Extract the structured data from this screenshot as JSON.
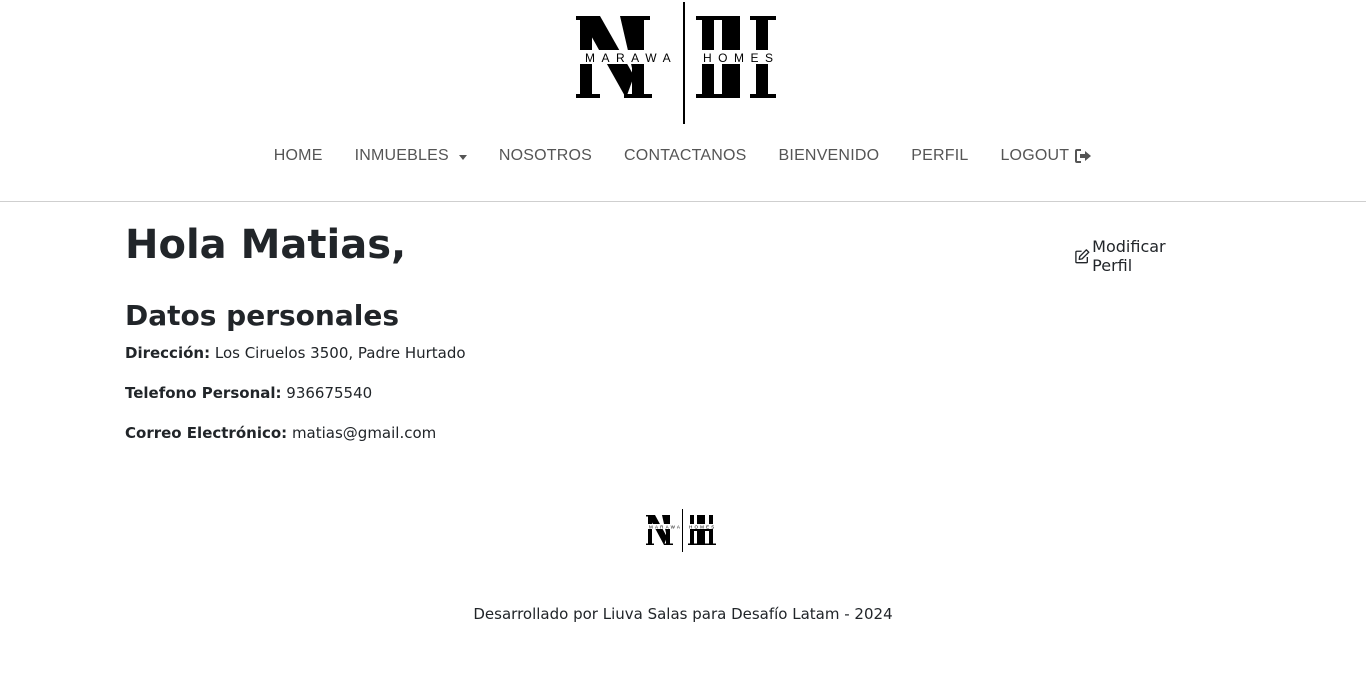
{
  "brand": {
    "logo_letters": "MH",
    "logo_text": "MARAWA HOMES"
  },
  "nav": {
    "items": [
      {
        "label": "HOME"
      },
      {
        "label": "INMUEBLES"
      },
      {
        "label": "NOSOTROS"
      },
      {
        "label": "CONTACTANOS"
      },
      {
        "label": "BIENVENIDO"
      },
      {
        "label": "PERFIL"
      },
      {
        "label": "LOGOUT"
      }
    ]
  },
  "profile": {
    "greeting": "Hola Matias,",
    "edit_label": "Modificar Perfil",
    "section_title": "Datos personales",
    "fields": [
      {
        "label": "Dirección:",
        "value": "Los Ciruelos 3500, Padre Hurtado"
      },
      {
        "label": "Telefono Personal:",
        "value": "936675540"
      },
      {
        "label": "Correo Electrónico:",
        "value": "matias@gmail.com"
      }
    ]
  },
  "footer": {
    "text": "Desarrollado por Liuva Salas para Desafío Latam - 2024"
  },
  "icons": {
    "dropdown": "caret-down-icon",
    "logout": "sign-out-icon",
    "edit": "edit-icon"
  }
}
